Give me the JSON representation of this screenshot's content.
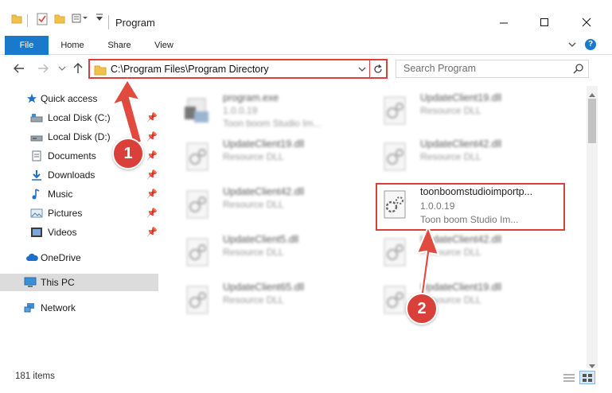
{
  "window": {
    "title": "Program",
    "minimize": "—",
    "maximize": "☐",
    "close": "✕"
  },
  "ribbon": {
    "tabs": [
      "File",
      "Home",
      "Share",
      "View"
    ],
    "help": "?"
  },
  "address": {
    "path": "C:\\Program Files\\Program Directory",
    "search_placeholder": "Search Program"
  },
  "nav": {
    "items": [
      {
        "label": "Quick access",
        "icon": "star-icon"
      },
      {
        "label": "Local Disk (C:)",
        "icon": "drive-icon",
        "pinned": true
      },
      {
        "label": "Local Disk (D:)",
        "icon": "drive-icon",
        "pinned": true
      },
      {
        "label": "Documents",
        "icon": "documents-icon",
        "pinned": true
      },
      {
        "label": "Downloads",
        "icon": "download-icon",
        "pinned": true
      },
      {
        "label": "Music",
        "icon": "music-icon",
        "pinned": true
      },
      {
        "label": "Pictures",
        "icon": "pictures-icon",
        "pinned": true
      },
      {
        "label": "Videos",
        "icon": "videos-icon",
        "pinned": true
      },
      {
        "label": "OneDrive",
        "icon": "cloud-icon"
      },
      {
        "label": "This PC",
        "icon": "computer-icon",
        "selected": true
      },
      {
        "label": "Network",
        "icon": "network-icon"
      }
    ]
  },
  "files": [
    {
      "name": "program.exe",
      "line2": "1.0.0.19",
      "line3": "Toon boom Studio Im..."
    },
    {
      "name": "UpdateClient19.dll",
      "line2": "Resource DLL"
    },
    {
      "name": "UpdateClient19.dll",
      "line2": "Resource DLL"
    },
    {
      "name": "UpdateClient42.dll",
      "line2": "Resource DLL"
    },
    {
      "name": "UpdateClient42.dll",
      "line2": "Resource DLL"
    },
    {
      "name": "toonboomstudioimportp...",
      "line2": "1.0.0.19",
      "line3": "Toon boom Studio Im..."
    },
    {
      "name": "UpdateClient5.dll",
      "line2": "Resource DLL"
    },
    {
      "name": "UpdateClient42.dll",
      "line2": "Resource DLL"
    },
    {
      "name": "UpdateClient65.dll",
      "line2": "Resource DLL"
    },
    {
      "name": "UpdateClient19.dll",
      "line2": "Resource DLL"
    }
  ],
  "status": {
    "item_count": "181 items"
  },
  "callouts": [
    "1",
    "2"
  ],
  "colors": {
    "accent": "#1979ca",
    "highlight": "#d9403a"
  }
}
